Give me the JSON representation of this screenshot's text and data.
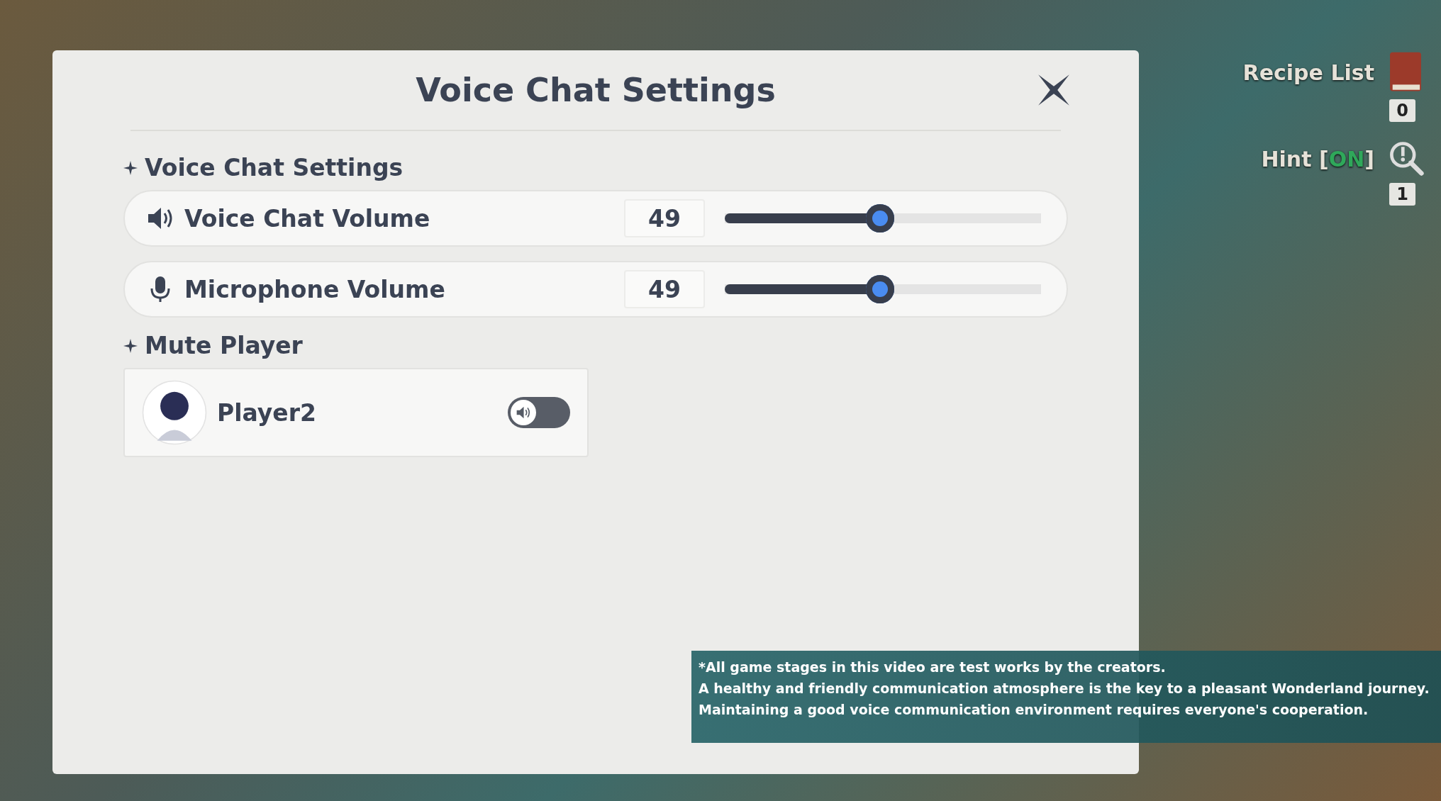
{
  "dialog": {
    "title": "Voice Chat Settings"
  },
  "sections": [
    {
      "heading": "Voice Chat Settings",
      "sliders": [
        {
          "kind": "speaker",
          "label": "Voice Chat Volume",
          "value": "49",
          "level": 0.49
        },
        {
          "kind": "microphone",
          "label": "Microphone Volume",
          "value": "49",
          "level": 0.49
        }
      ]
    },
    {
      "heading": "Mute Player",
      "players": [
        {
          "name": "Player2",
          "muted": false
        }
      ]
    }
  ],
  "hud": {
    "recipe_list": "Recipe List",
    "recipe_count": "0",
    "hint": {
      "prefix": "Hint [",
      "value": "ON",
      "suffix": "]",
      "on": true
    },
    "hint_count": "1"
  },
  "caption": [
    "*All game stages in this video are test works by the creators.",
    "A healthy and friendly communication atmosphere is the key to a pleasant Wonderland journey.",
    "Maintaining a good voice communication environment requires everyone's cooperation."
  ]
}
